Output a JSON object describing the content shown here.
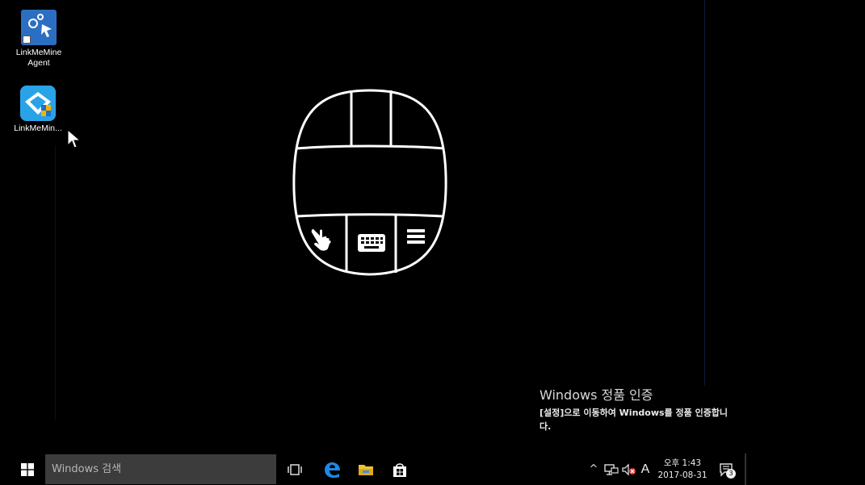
{
  "desktop": {
    "icons": [
      {
        "label": "LinkMeMine Agent",
        "icon": "link-settings-icon"
      },
      {
        "label": "LinkMeMin...",
        "icon": "linkmemine-app-icon"
      }
    ]
  },
  "activation": {
    "title": "Windows 정품 인증",
    "description": "[설정]으로 이동하여 Windows를 정품 인증합니다."
  },
  "taskbar": {
    "search_placeholder": "Windows 검색",
    "apps": [
      "task-view-icon",
      "edge-icon",
      "file-explorer-icon",
      "store-icon"
    ],
    "tray": {
      "chevron": "^",
      "ime": "A",
      "time": "오후 1:43",
      "date": "2017-08-31",
      "notifications": "3"
    }
  },
  "colors": {
    "background": "#000000",
    "taskbar": "#000000",
    "search_box": "#3c3c3c",
    "edge_blue": "#1e88e5",
    "explorer_yellow": "#f2c230"
  }
}
